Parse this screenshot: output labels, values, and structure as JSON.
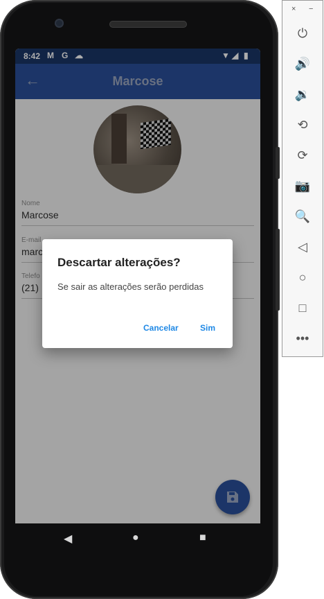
{
  "status_bar": {
    "time": "8:42",
    "notif_icons": [
      "gmail-icon",
      "google-icon",
      "cloud-icon"
    ],
    "right_icons": [
      "wifi-icon",
      "signal-icon",
      "battery-icon"
    ]
  },
  "app_bar": {
    "title": "Marcose",
    "back_icon": "arrow-left-icon"
  },
  "form": {
    "fields": [
      {
        "label": "Nome",
        "value": "Marcose"
      },
      {
        "label": "E-mail",
        "value": "marc"
      },
      {
        "label": "Telefo",
        "value": "(21)"
      }
    ]
  },
  "dialog": {
    "title": "Descartar alterações?",
    "message": "Se sair as alterações serão perdidas",
    "cancel_label": "Cancelar",
    "confirm_label": "Sim",
    "accent_color": "#1e88e5"
  },
  "fab": {
    "icon": "save-icon",
    "color": "#2a4f9a"
  },
  "emulator_toolbar": {
    "close": "×",
    "minimize": "−",
    "buttons": [
      "power-icon",
      "volume-up-icon",
      "volume-down-icon",
      "rotate-left-icon",
      "rotate-right-icon",
      "camera-icon",
      "zoom-icon",
      "back-icon",
      "home-icon",
      "overview-icon",
      "more-icon"
    ]
  }
}
